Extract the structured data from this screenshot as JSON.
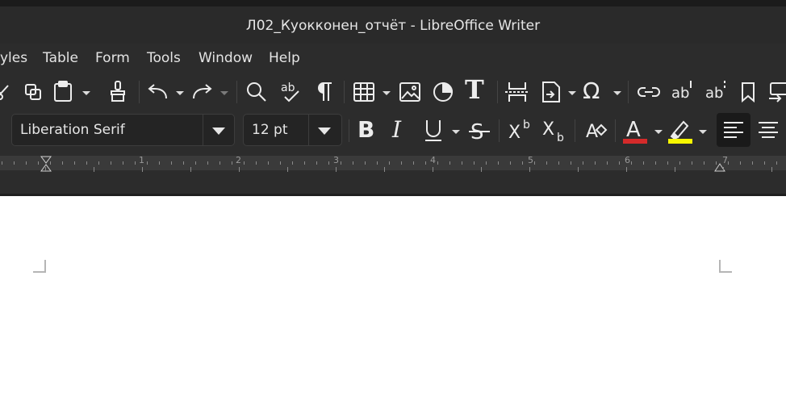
{
  "window": {
    "title": "Л02_Куокконен_отчёт - LibreOffice Writer"
  },
  "menu": [
    "yles",
    "Table",
    "Form",
    "Tools",
    "Window",
    "Help"
  ],
  "formatting": {
    "font_name": "Liberation Serif",
    "font_size": "12 pt"
  },
  "ruler": {
    "numbers": [
      "1",
      "2",
      "3",
      "4",
      "5",
      "6",
      "7"
    ]
  },
  "colors": {
    "font_color": "#d42a2a",
    "highlight_color": "#f7f700",
    "background": "#2c2c2c"
  }
}
